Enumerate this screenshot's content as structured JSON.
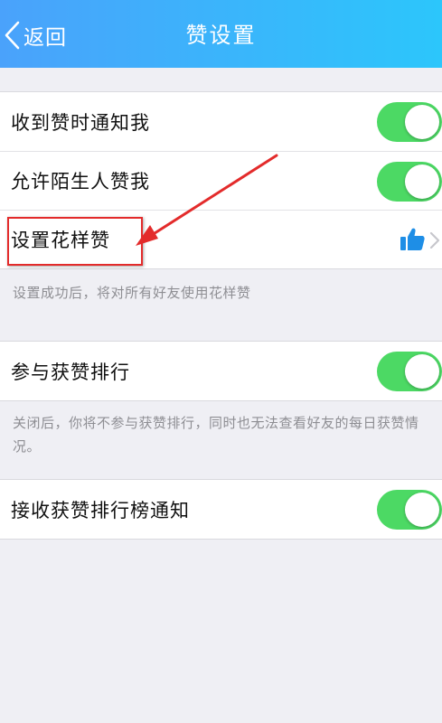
{
  "header": {
    "back_label": "返回",
    "title": "赞设置",
    "gradient_start": "#4aa2fb",
    "gradient_end": "#2cc6fb"
  },
  "settings": {
    "notify_on_like": {
      "label": "收到赞时通知我",
      "enabled": true
    },
    "allow_strangers": {
      "label": "允许陌生人赞我",
      "enabled": true
    },
    "fancy_like": {
      "label": "设置花样赞",
      "icon": "thumbs-up-icon"
    }
  },
  "note_fancy": "设置成功后，将对所有好友使用花样赞",
  "ranking": {
    "label": "参与获赞排行",
    "enabled": true
  },
  "note_ranking": "关闭后，你将不参与获赞排行，同时也无法查看好友的每日获赞情况。",
  "ranking_notify": {
    "label": "接收获赞排行榜通知",
    "enabled": true
  },
  "colors": {
    "toggle_on": "#4cd964",
    "annotation": "#e32b2b",
    "thumb_icon": "#1e8ee6"
  }
}
